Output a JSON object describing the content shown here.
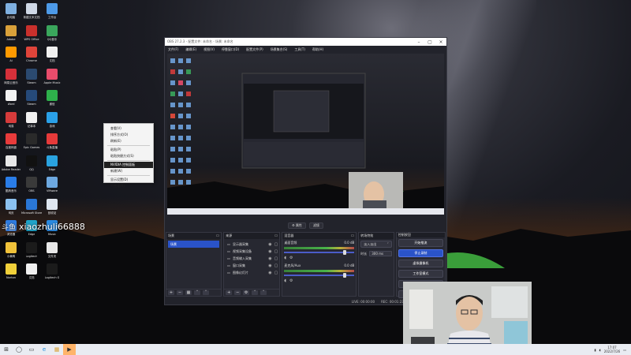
{
  "desktop": {
    "watermark_handle": "xiaozhuli66888",
    "watermark_prefix": "斗鱼",
    "icons": [
      {
        "label": "此电脑",
        "color": "#7fb0e0"
      },
      {
        "label": "新建文本文档",
        "color": "#cfd8e6"
      },
      {
        "label": "工作台",
        "color": "#4d9ae8"
      },
      {
        "label": "Adobe",
        "color": "#d9a13a"
      },
      {
        "label": "WPS Office",
        "color": "#c9302c"
      },
      {
        "label": "QQ音乐",
        "color": "#3aa65c"
      },
      {
        "label": "Ai",
        "color": "#ff9a00"
      },
      {
        "label": "Chrome",
        "color": "#e0443a"
      },
      {
        "label": "文档",
        "color": "#f0f0f0"
      },
      {
        "label": "网易云音乐",
        "color": "#d6303a"
      },
      {
        "label": "Steam",
        "color": "#2b4a70"
      },
      {
        "label": "Apple Music",
        "color": "#e84c6b"
      },
      {
        "label": "Word",
        "color": "#f3f3f3"
      },
      {
        "label": "Steam",
        "color": "#264a7a"
      },
      {
        "label": "微信",
        "color": "#2eb04b"
      },
      {
        "label": "网易",
        "color": "#d63b3b"
      },
      {
        "label": "记事本",
        "color": "#f2f2f2"
      },
      {
        "label": "游戏",
        "color": "#2aa0e8"
      },
      {
        "label": "百度网盘",
        "color": "#e83b3b"
      },
      {
        "label": "Epic Games",
        "color": "#2a2a2a"
      },
      {
        "label": "斗鱼直播",
        "color": "#e63a3a"
      },
      {
        "label": "Adobe Reader",
        "color": "#e8e8e8"
      },
      {
        "label": "QQ",
        "color": "#111111"
      },
      {
        "label": "Edge",
        "color": "#2aa3e0"
      },
      {
        "label": "酷狗音乐",
        "color": "#2a7de8"
      },
      {
        "label": "OBS",
        "color": "#3a3a3a"
      },
      {
        "label": "VMware",
        "color": "#6da8e0"
      },
      {
        "label": "网页",
        "color": "#8cc2f0"
      },
      {
        "label": "Microsoft Store",
        "color": "#2a77d6"
      },
      {
        "label": "回收站",
        "color": "#dfe6ef"
      },
      {
        "label": "浏览器",
        "color": "#2e7be0"
      },
      {
        "label": "Edge",
        "color": "#1fa3c8"
      },
      {
        "label": "Music",
        "color": "#2a8ae0"
      },
      {
        "label": "小黄鸭",
        "color": "#f0c23a"
      },
      {
        "label": "Logitech",
        "color": "#1b1b1b"
      },
      {
        "label": "文件夹",
        "color": "#e8e8e8"
      },
      {
        "label": "Norton",
        "color": "#f0d03a"
      },
      {
        "label": "文档",
        "color": "#f0f0f0"
      },
      {
        "label": "Logitech G",
        "color": "#1b1b1b"
      }
    ]
  },
  "context_menu": {
    "items": [
      {
        "label": "查看(V)",
        "highlight": false
      },
      {
        "label": "排序方式(O)",
        "highlight": false
      },
      {
        "label": "刷新(E)",
        "highlight": false
      },
      {
        "sep": true
      },
      {
        "label": "粘贴(P)",
        "highlight": false
      },
      {
        "label": "粘贴快捷方式(S)",
        "highlight": false
      },
      {
        "sep": true
      },
      {
        "label": "NVIDIA 控制面板",
        "highlight": true
      },
      {
        "label": "新建(W)",
        "highlight": false
      },
      {
        "sep": true
      },
      {
        "label": "显示设置(D)",
        "highlight": false
      },
      {
        "label": "个性化(R)",
        "highlight": false
      }
    ]
  },
  "obs": {
    "title": "OBS 27.2.3 - 配置文件: 未命名 - 场景: 未命名",
    "menu": [
      "文件(F)",
      "编辑(E)",
      "视图(V)",
      "停靠窗口(D)",
      "配置文件(P)",
      "场景集合(S)",
      "工具(T)",
      "帮助(H)"
    ],
    "preview_buttons": [
      "⚙ 属性",
      "滤镜"
    ],
    "scenes": {
      "header": "场景",
      "items": [
        "场景"
      ]
    },
    "sources": {
      "header": "来源",
      "items": [
        "显示器采集",
        "视频采集设备",
        "音频输入采集",
        "窗口采集",
        "图像幻灯片"
      ]
    },
    "mixer": {
      "header": "混音器",
      "channels": [
        {
          "name": "桌面音频",
          "db": "0.0 dB"
        },
        {
          "name": "麦克风/Aux",
          "db": "0.0 dB"
        }
      ]
    },
    "transitions": {
      "header": "转场特效",
      "selected": "淡入淡出",
      "duration_label": "时长",
      "duration": "300 ms"
    },
    "controls": {
      "header": "控制按钮",
      "buttons": [
        {
          "label": "开始推流",
          "on": false
        },
        {
          "label": "停止录制",
          "on": true
        },
        {
          "label": "虚拟摄像机",
          "on": false
        },
        {
          "label": "工作室模式",
          "on": false
        },
        {
          "label": "设置",
          "on": false
        },
        {
          "label": "退出",
          "on": false
        }
      ]
    },
    "status": {
      "live": "LIVE: 00:00:00",
      "rec": "REC: 00:01:23",
      "cpu": "CPU: 3.5%, 30.00 fps"
    }
  },
  "taskbar": {
    "items": [
      "⊞",
      "◯",
      "▭",
      "e",
      "▦",
      "▶"
    ],
    "time": "17:07",
    "date": "2022/7/26"
  }
}
